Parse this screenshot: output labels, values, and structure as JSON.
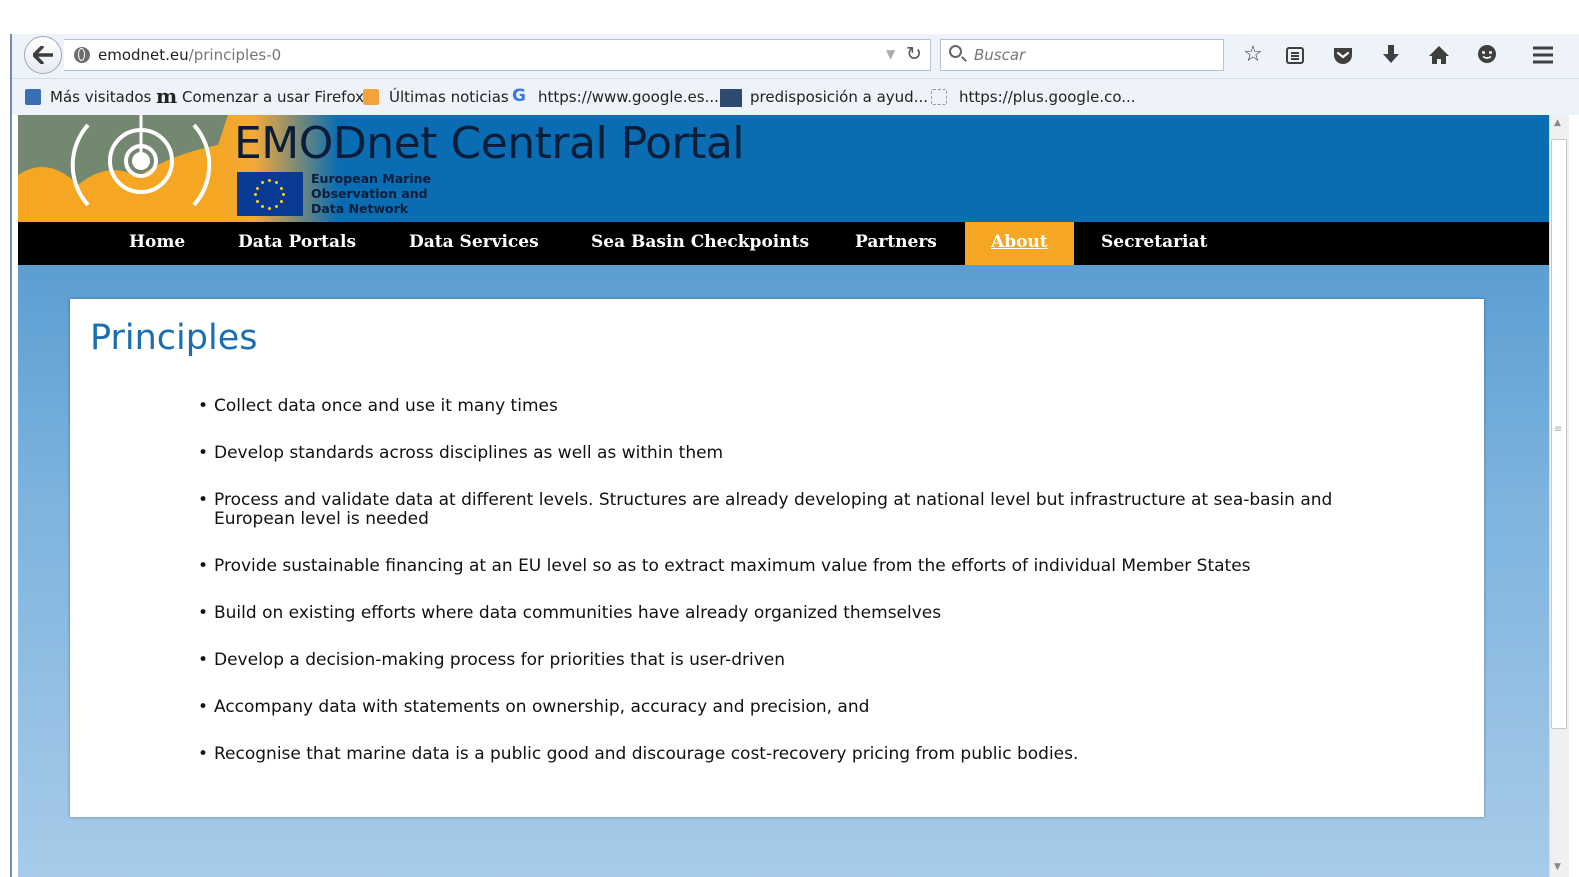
{
  "browser": {
    "url_domain": "emodnet.eu",
    "url_path": "/principles-0",
    "search_placeholder": "Buscar",
    "bookmarks": [
      "Más visitados",
      "Comenzar a usar Firefox",
      "Últimas noticias",
      "https://www.google.es...",
      "predisposición a ayud...",
      "https://plus.google.co..."
    ]
  },
  "header": {
    "title": "EMODnet Central Portal",
    "subtitle": "European Marine\nObservation and\nData Network"
  },
  "nav": {
    "items": [
      "Home",
      "Data Portals",
      "Data Services",
      "Sea Basin Checkpoints",
      "Partners",
      "About",
      "Secretariat"
    ],
    "active": "About"
  },
  "content": {
    "title": "Principles",
    "principles": [
      "Collect data once and use it many times",
      "Develop standards across disciplines as well as within them",
      "Process and validate data at different levels. Structures are already developing at national level but infrastructure at sea-basin and European level is needed",
      "Provide sustainable financing at an EU level so as to extract maximum value from the efforts of individual Member States",
      "Build on existing efforts where data communities have already organized themselves",
      "Develop a decision-making process for priorities that is user-driven",
      "Accompany data with statements on ownership, accuracy and precision, and",
      "Recognise that marine data is a public good and discourage cost-recovery pricing from public bodies."
    ]
  },
  "colors": {
    "header_blue": "#0a6db3",
    "accent_orange": "#f5a623",
    "nav_black": "#000000",
    "title_blue": "#1b6fb0"
  }
}
